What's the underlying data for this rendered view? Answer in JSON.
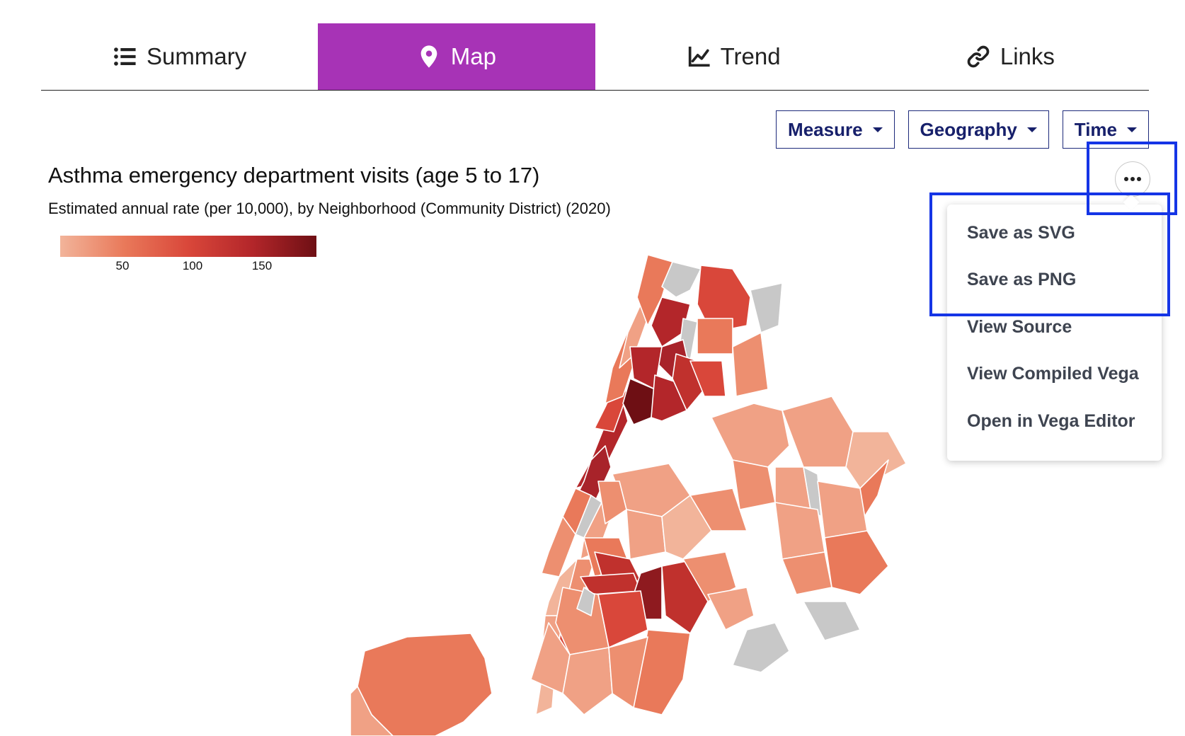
{
  "tabs": [
    {
      "label": "Summary",
      "icon": "list-icon",
      "active": false
    },
    {
      "label": "Map",
      "icon": "map-pin-icon",
      "active": true
    },
    {
      "label": "Trend",
      "icon": "line-chart-icon",
      "active": false
    },
    {
      "label": "Links",
      "icon": "link-icon",
      "active": false
    }
  ],
  "controls": {
    "measure": "Measure",
    "geography": "Geography",
    "time": "Time"
  },
  "chart": {
    "title": "Asthma emergency department visits (age 5 to 17)",
    "subtitle": "Estimated annual rate (per 10,000), by Neighborhood (Community District) (2020)"
  },
  "legend": {
    "ticks": [
      "50",
      "100",
      "150"
    ],
    "color_low": "#f2b49a",
    "color_high": "#6e0f14",
    "no_data_color": "#c8c8c8"
  },
  "actions_menu": {
    "button_icon": "more-horizontal-icon",
    "items": [
      "Save as SVG",
      "Save as PNG",
      "View Source",
      "View Compiled Vega",
      "Open in Vega Editor"
    ]
  },
  "colors": {
    "active_tab": "#a733b6",
    "control_text": "#17206b",
    "highlight": "#1535e6"
  }
}
